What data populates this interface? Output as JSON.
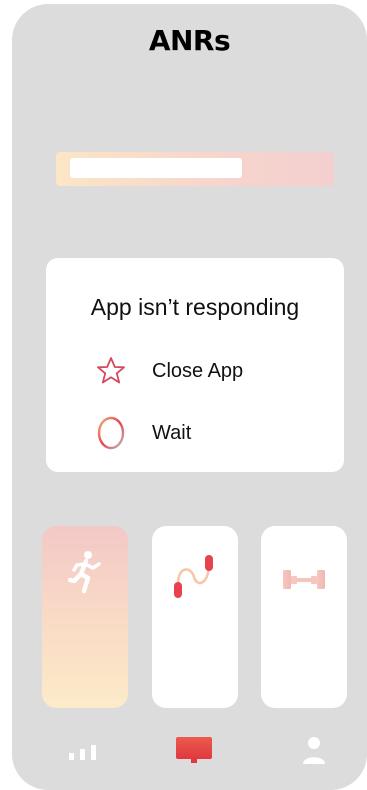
{
  "screen": {
    "title": "ANRs"
  },
  "dialog": {
    "title": "App isn’t responding",
    "options": [
      {
        "label": "Close App",
        "icon": "star-icon"
      },
      {
        "label": "Wait",
        "icon": "loading-ring-icon"
      }
    ]
  },
  "cards": [
    {
      "icon": "running-icon"
    },
    {
      "icon": "jump-rope-icon"
    },
    {
      "icon": "dumbbell-icon"
    }
  ],
  "nav": [
    {
      "icon": "stats-bars-icon"
    },
    {
      "icon": "dashboard-icon"
    },
    {
      "icon": "profile-icon"
    }
  ],
  "colors": {
    "background": "#dcdcdc",
    "accent_red": "#e8424f",
    "star_stroke": "#d9475e",
    "card_gradient_top": "#f3c8c6",
    "card_gradient_bottom": "#fcebc8"
  }
}
